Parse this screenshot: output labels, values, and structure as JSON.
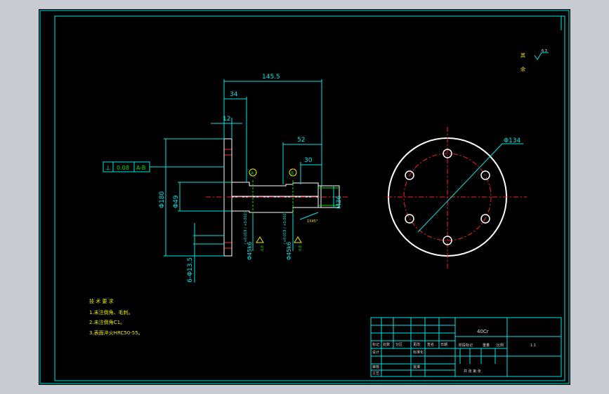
{
  "colors": {
    "background": "#000000",
    "dimension": "#00e5e5",
    "outline": "#ffffff",
    "centerline": "#ff2222",
    "hatch": "#00dd00",
    "window": "#c8ccd2"
  },
  "roughness": {
    "label1": "其",
    "label2": "余",
    "value": "6.3"
  },
  "dims": {
    "overall": "145.5",
    "d34": "34",
    "d12": "12",
    "d52": "52",
    "d30": "30",
    "phi180": "Φ180",
    "phi49": "Φ49",
    "m36": "M36",
    "hole": "6-Φ13.5",
    "chamfer": "1X45°",
    "phi45a": "Φ45k6",
    "phi45a_tol": "(+0.018 / +0.002)",
    "phi45b": "Φ45k6",
    "phi45b_tol": "(+0.018 / +0.002)",
    "roughA": "0.8",
    "roughB": "0.8",
    "datumA": "A",
    "datumB": "B",
    "phi134": "Φ134"
  },
  "tolerance_frame": {
    "symbol": "⊥",
    "value": "0.08",
    "datum": "A-B"
  },
  "tech_req": {
    "title": "技 术 要 求",
    "items": [
      "1.未注倒角、毛刺。",
      "2.未注倒角C1。",
      "3.表面淬火HRC50-55。"
    ]
  },
  "title_block": {
    "material": "40Cr",
    "cells": [
      "标记",
      "处数",
      "分区",
      "更改",
      "签名",
      "日期",
      "设计",
      "标准化",
      "审核",
      "工艺",
      "批准",
      "阶段标记",
      "重量",
      "比例",
      "1:1",
      "共 张 第 张"
    ]
  }
}
